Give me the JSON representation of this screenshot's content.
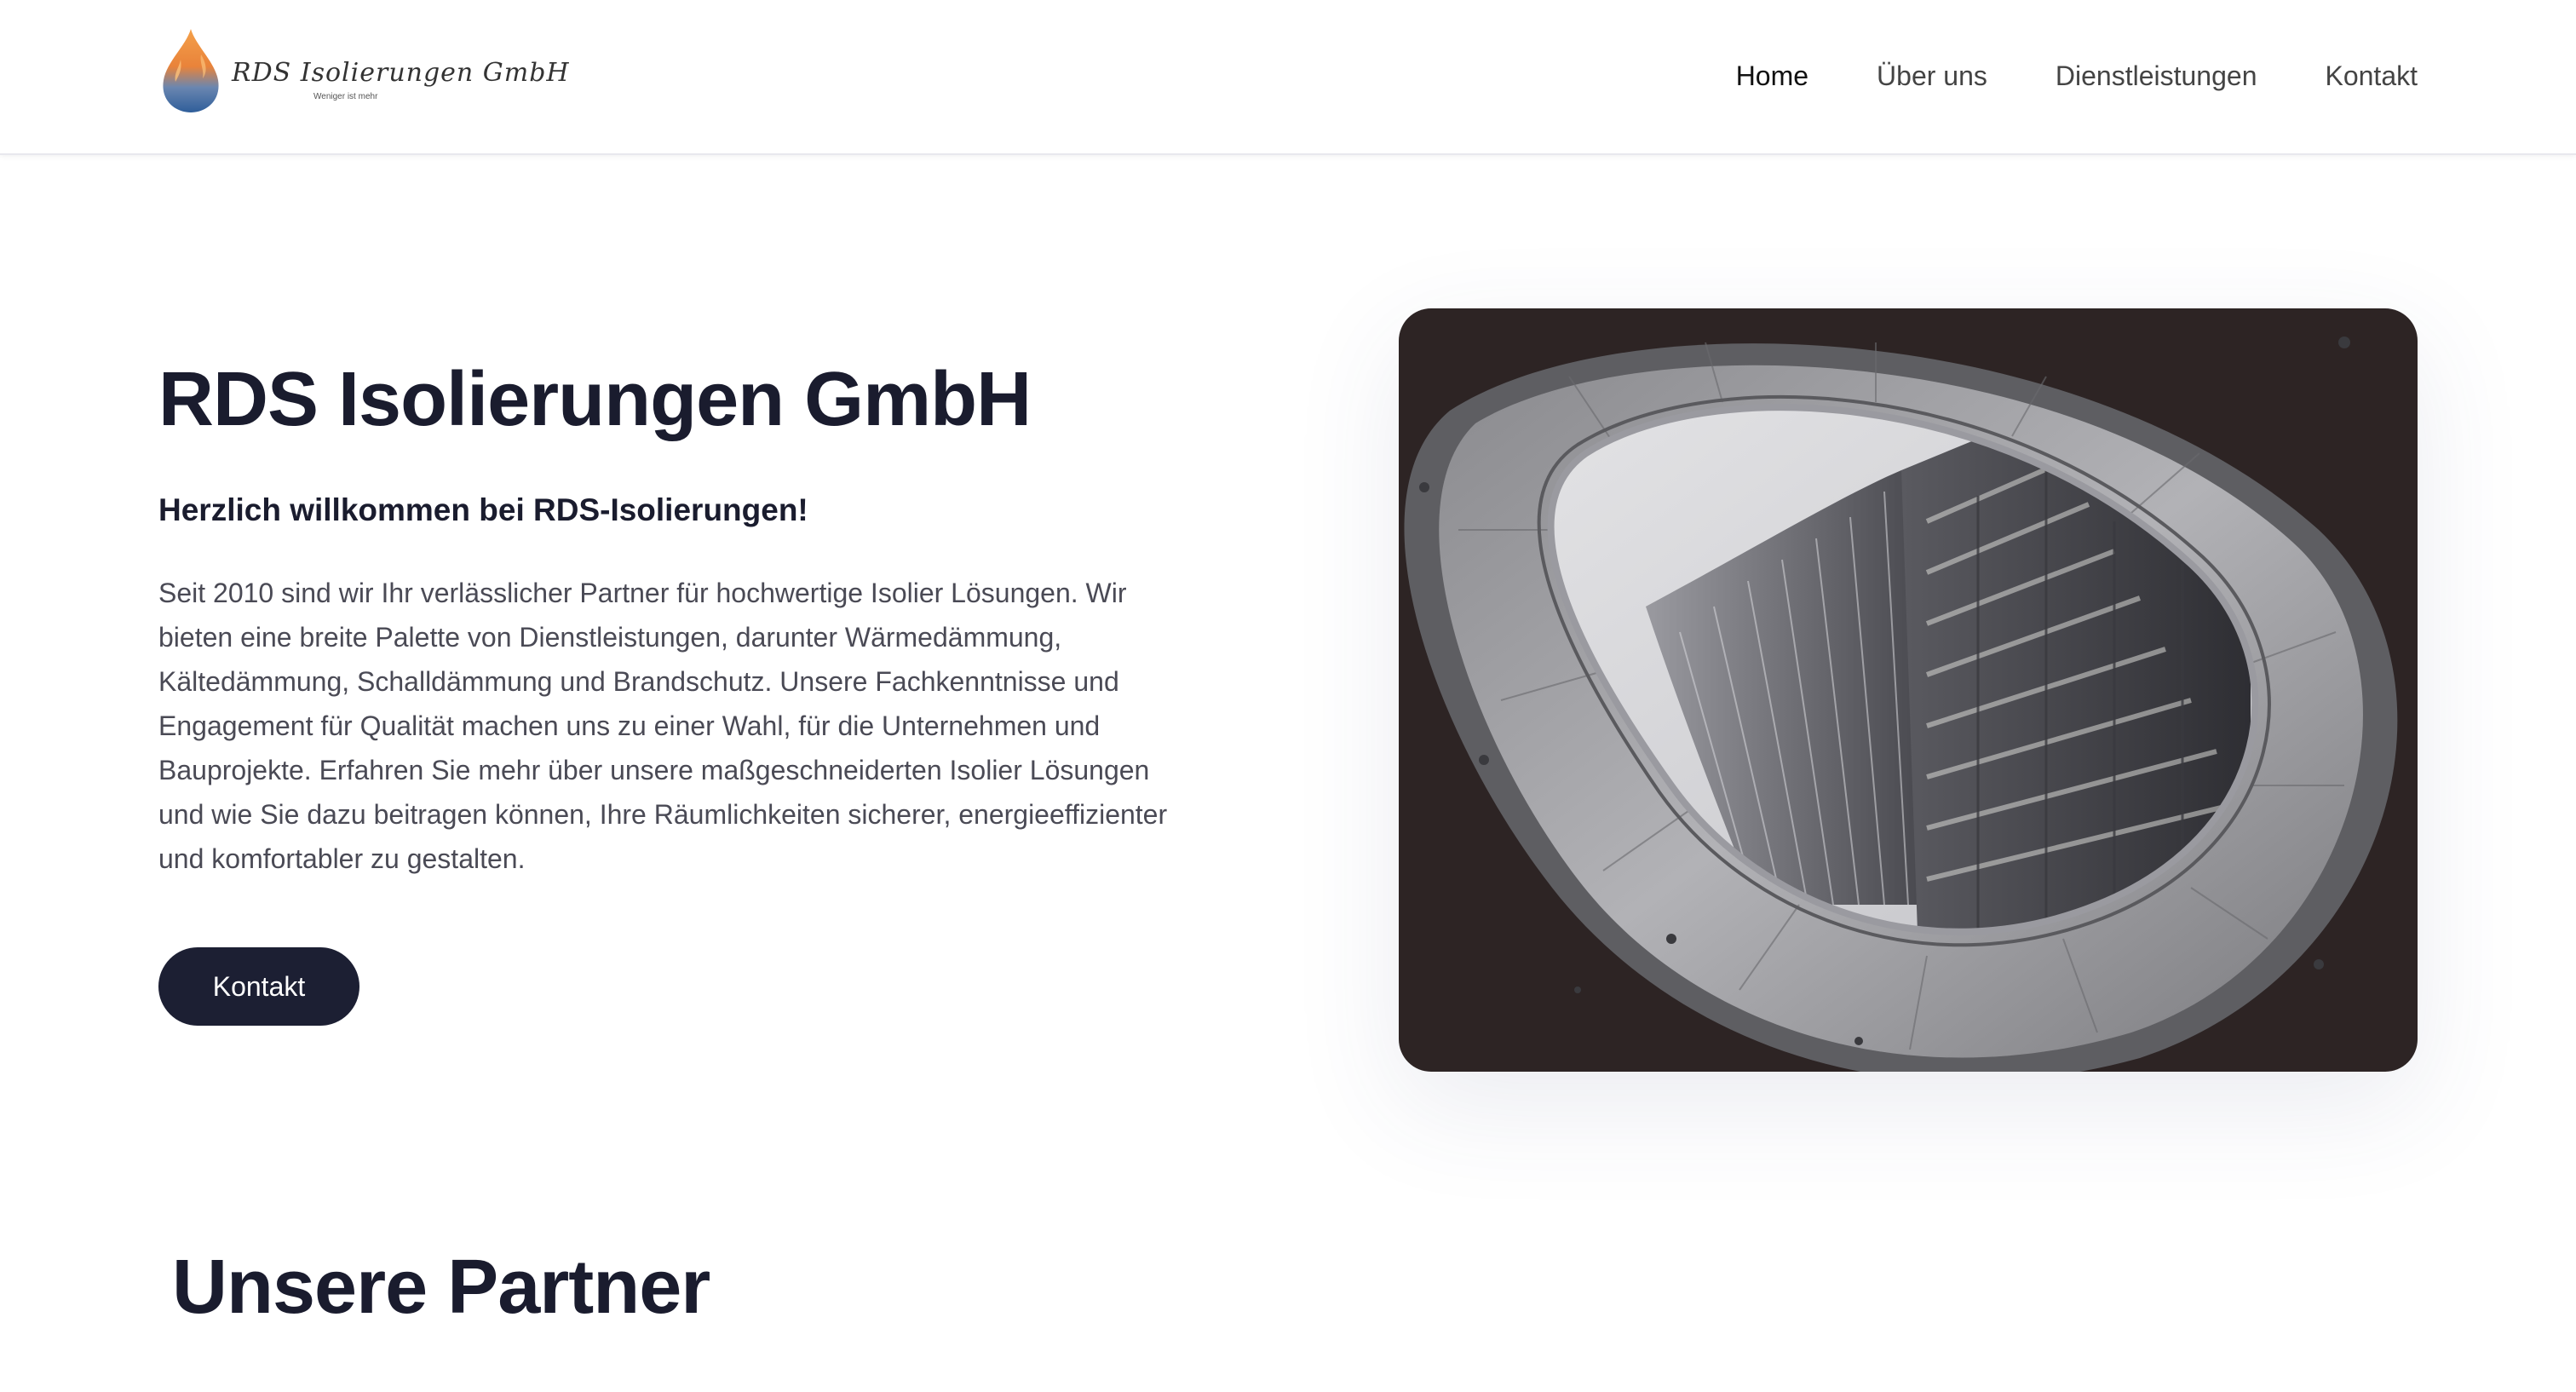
{
  "brand": {
    "name": "RDS Isolierungen GmbH",
    "tagline": "Weniger ist mehr",
    "icon": "flame-drop-logo-icon"
  },
  "nav": {
    "items": [
      {
        "label": "Home",
        "active": true
      },
      {
        "label": "Über uns",
        "active": false
      },
      {
        "label": "Dienstleistungen",
        "active": false
      },
      {
        "label": "Kontakt",
        "active": false
      }
    ]
  },
  "hero": {
    "title": "RDS Isolierungen GmbH",
    "subtitle": "Herzlich willkommen bei RDS-Isolierungen!",
    "body": "Seit 2010 sind wir Ihr verlässlicher Partner für hochwertige Isolier Lösungen. Wir bieten eine breite Palette von Dienstleistungen, darunter Wärmedämmung, Kältedämmung, Schalldämmung und Brandschutz. Unsere Fachkenntnisse und Engagement für Qualität machen uns zu einer Wahl, für die Unternehmen und Bauprojekte. Erfahren Sie mehr über unsere maßgeschneiderten Isolier Lösungen und wie Sie dazu beitragen können, Ihre Räumlichkeiten sicherer, energieeffizienter und komfortabler zu gestalten.",
    "cta_label": "Kontakt"
  },
  "partners": {
    "title": "Unsere Partner"
  },
  "colors": {
    "primary_dark": "#1c1f33",
    "text_body": "#4a4a55",
    "logo_orange": "#f08a3a",
    "logo_blue": "#3d6fa8"
  }
}
